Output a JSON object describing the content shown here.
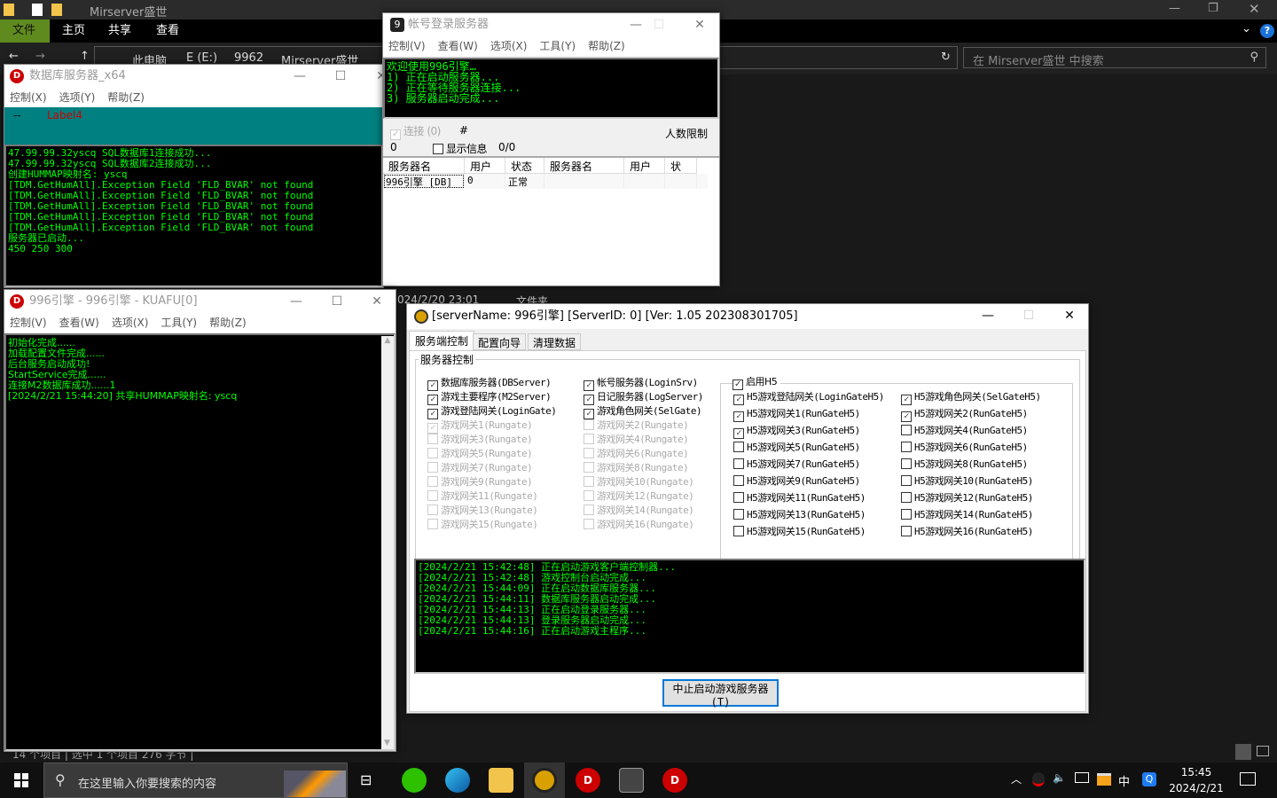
{
  "explorer": {
    "title": "Mirserver盛世",
    "ribbon": [
      "文件",
      "主页",
      "共享",
      "查看"
    ],
    "breadcrumb": [
      "此电脑",
      "E (E:)",
      "9962",
      "Mirserver盛世"
    ],
    "search_placeholder": "在 Mirserver盛世 中搜索",
    "file_row": {
      "date": "024/2/20 23:01",
      "type": "文件夹"
    },
    "status": "14 个项目 | 选中 1 个项目 276 字节 |",
    "accent": "#5f8b1e"
  },
  "db_window": {
    "title": "数据库服务器_x64",
    "menu": [
      "控制(X)",
      "选项(Y)",
      "帮助(Z)"
    ],
    "panel": {
      "dash": "--",
      "label": "Label4"
    },
    "log": [
      "47.99.99.32yscq SQL数据库1连接成功...",
      "47.99.99.32yscq SQL数据库2连接成功...",
      "创建HUMMAP映射名: yscq",
      "[TDM.GetHumAll].Exception Field 'FLD_BVAR' not found",
      "[TDM.GetHumAll].Exception Field 'FLD_BVAR' not found",
      "[TDM.GetHumAll].Exception Field 'FLD_BVAR' not found",
      "[TDM.GetHumAll].Exception Field 'FLD_BVAR' not found",
      "[TDM.GetHumAll].Exception Field 'FLD_BVAR' not found",
      "服务器已启动...",
      "450 250 300"
    ]
  },
  "login_window": {
    "title": "帐号登录服务器",
    "menu": [
      "控制(V)",
      "查看(W)",
      "选项(X)",
      "工具(Y)",
      "帮助(Z)"
    ],
    "log": [
      "欢迎使用996引擎…",
      "1) 正在启动服务器...",
      "2) 正在等待服务器连接...",
      "3) 服务器启动完成..."
    ],
    "connect_label": "连接",
    "connect_count": "(0)",
    "hash": "#",
    "limit_label": "人数限制",
    "count": "0",
    "show_info": "显示信息",
    "ratio": "0/0",
    "columns": [
      "服务器名",
      "用户数",
      "状态",
      "服务器名",
      "用户数",
      "状态"
    ],
    "rows": [
      [
        "996引擎 [DB]",
        "0",
        "正常",
        "",
        "",
        ""
      ]
    ]
  },
  "m2_window": {
    "title": "996引擎 - 996引擎 - KUAFU[0]",
    "menu": [
      "控制(V)",
      "查看(W)",
      "选项(X)",
      "工具(Y)",
      "帮助(Z)"
    ],
    "log": [
      "初始化完成......",
      "加载配置文件完成......",
      "后台服务启动成功!",
      "StartService完成......",
      "连接M2数据库成功......1",
      "[2024/2/21 15:44:20] 共享HUMMAP映射名: yscq"
    ]
  },
  "control_window": {
    "title": "[serverName: 996引擎] [ServerID: 0] [Ver:  1.05 202308301705]",
    "tabs": [
      "服务端控制",
      "配置向导",
      "清理数据"
    ],
    "group": "服务器控制",
    "servers_left": [
      {
        "label": "数据库服务器(DBServer)",
        "checked": true,
        "enabled": true
      },
      {
        "label": "游戏主要程序(M2Server)",
        "checked": true,
        "enabled": true
      },
      {
        "label": "游戏登陆网关(LoginGate)",
        "checked": true,
        "enabled": true
      },
      {
        "label": "游戏网关1(Rungate)",
        "checked": true,
        "enabled": false
      },
      {
        "label": "游戏网关3(Rungate)",
        "checked": false,
        "enabled": false
      },
      {
        "label": "游戏网关5(Rungate)",
        "checked": false,
        "enabled": false
      },
      {
        "label": "游戏网关7(Rungate)",
        "checked": false,
        "enabled": false
      },
      {
        "label": "游戏网关9(Rungate)",
        "checked": false,
        "enabled": false
      },
      {
        "label": "游戏网关11(Rungate)",
        "checked": false,
        "enabled": false
      },
      {
        "label": "游戏网关13(Rungate)",
        "checked": false,
        "enabled": false
      },
      {
        "label": "游戏网关15(Rungate)",
        "checked": false,
        "enabled": false
      }
    ],
    "servers_right": [
      {
        "label": "帐号服务器(LoginSrv)",
        "checked": true,
        "enabled": true
      },
      {
        "label": "日记服务器(LogServer)",
        "checked": true,
        "enabled": true
      },
      {
        "label": "游戏角色网关(SelGate)",
        "checked": true,
        "enabled": true
      },
      {
        "label": "游戏网关2(Rungate)",
        "checked": false,
        "enabled": false
      },
      {
        "label": "游戏网关4(Rungate)",
        "checked": false,
        "enabled": false
      },
      {
        "label": "游戏网关6(Rungate)",
        "checked": false,
        "enabled": false
      },
      {
        "label": "游戏网关8(Rungate)",
        "checked": false,
        "enabled": false
      },
      {
        "label": "游戏网关10(Rungate)",
        "checked": false,
        "enabled": false
      },
      {
        "label": "游戏网关12(Rungate)",
        "checked": false,
        "enabled": false
      },
      {
        "label": "游戏网关14(Rungate)",
        "checked": false,
        "enabled": false
      },
      {
        "label": "游戏网关16(Rungate)",
        "checked": false,
        "enabled": false
      }
    ],
    "h5_enable": {
      "label": "启用H5",
      "checked": true
    },
    "h5_left": [
      {
        "label": "H5游戏登陆网关(LoginGateH5)",
        "checked": true
      },
      {
        "label": "H5游戏网关1(RunGateH5)",
        "checked": true
      },
      {
        "label": "H5游戏网关3(RunGateH5)",
        "checked": true
      },
      {
        "label": "H5游戏网关5(RunGateH5)",
        "checked": false
      },
      {
        "label": "H5游戏网关7(RunGateH5)",
        "checked": false
      },
      {
        "label": "H5游戏网关9(RunGateH5)",
        "checked": false
      },
      {
        "label": "H5游戏网关11(RunGateH5)",
        "checked": false
      },
      {
        "label": "H5游戏网关13(RunGateH5)",
        "checked": false
      },
      {
        "label": "H5游戏网关15(RunGateH5)",
        "checked": false
      }
    ],
    "h5_right": [
      {
        "label": "H5游戏角色网关(SelGateH5)",
        "checked": true
      },
      {
        "label": "H5游戏网关2(RunGateH5)",
        "checked": true
      },
      {
        "label": "H5游戏网关4(RunGateH5)",
        "checked": false
      },
      {
        "label": "H5游戏网关6(RunGateH5)",
        "checked": false
      },
      {
        "label": "H5游戏网关8(RunGateH5)",
        "checked": false
      },
      {
        "label": "H5游戏网关10(RunGateH5)",
        "checked": false
      },
      {
        "label": "H5游戏网关12(RunGateH5)",
        "checked": false
      },
      {
        "label": "H5游戏网关14(RunGateH5)",
        "checked": false
      },
      {
        "label": "H5游戏网关16(RunGateH5)",
        "checked": false
      }
    ],
    "log": [
      "[2024/2/21 15:42:48] 正在启动游戏客户端控制器...",
      "[2024/2/21 15:42:48] 游戏控制台启动完成...",
      "[2024/2/21 15:44:09] 正在启动数据库服务器...",
      "[2024/2/21 15:44:11] 数据库服务器启动完成...",
      "[2024/2/21 15:44:13] 正在启动登录服务器...",
      "[2024/2/21 15:44:13] 登录服务器启动完成...",
      "[2024/2/21 15:44:16] 正在启动游戏主程序..."
    ],
    "stop_button": "中止启动游戏服务器(T)"
  },
  "taskbar": {
    "search_placeholder": "在这里输入你要搜索的内容",
    "time": "15:45",
    "date": "2024/2/21",
    "ime": "中",
    "apps": [
      "task-view",
      "wechat",
      "edge",
      "file-explorer",
      "game-engine",
      "db-server",
      "m2-console",
      "login-server"
    ]
  }
}
